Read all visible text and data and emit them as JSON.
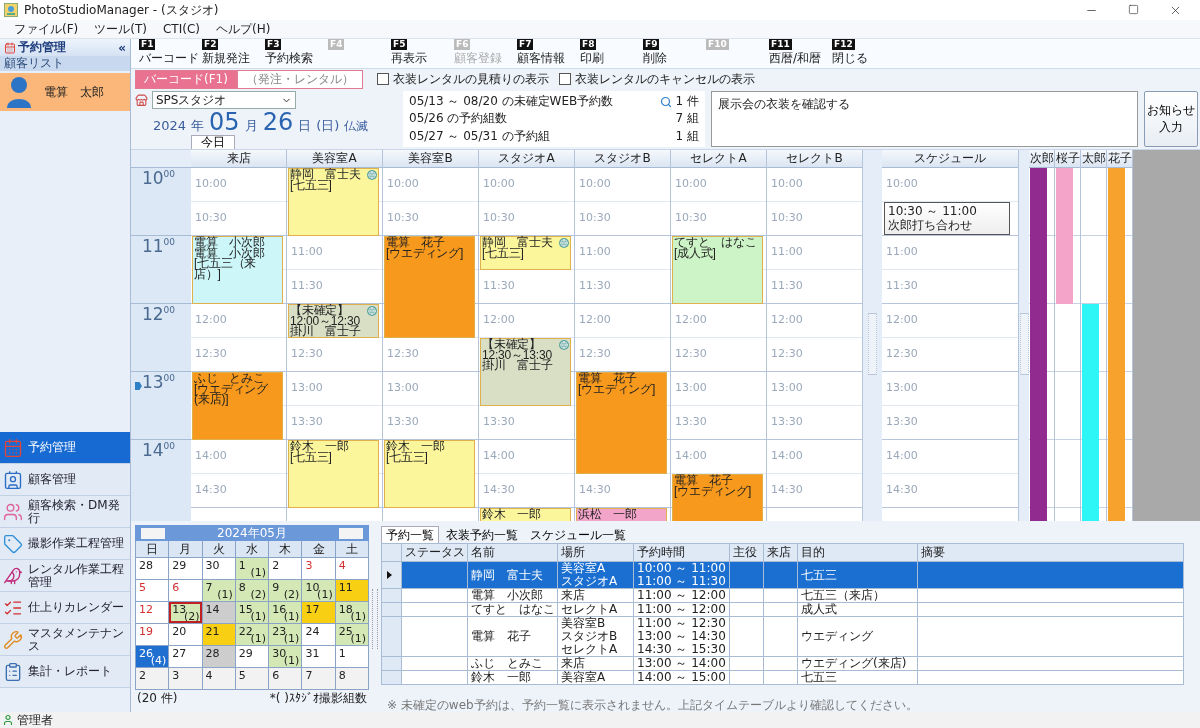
{
  "window": {
    "title": "PhotoStudioManager - (スタジオ)"
  },
  "menu": [
    "ファイル(F)",
    "ツール(T)",
    "CTI(C)",
    "ヘルプ(H)"
  ],
  "sidebar": {
    "title": "予約管理",
    "collapse": "«",
    "list_title": "顧客リスト",
    "customers": [
      {
        "name": "電算　太郎",
        "selected": true
      }
    ],
    "nav": [
      {
        "label": "予約管理",
        "selected": true
      },
      {
        "label": "顧客管理",
        "selected": false
      },
      {
        "label": "顧客検索・DM発行",
        "selected": false
      },
      {
        "label": "撮影作業工程管理",
        "selected": false
      },
      {
        "label": "レンタル作業工程管理",
        "selected": false
      },
      {
        "label": "仕上りカレンダー",
        "selected": false
      },
      {
        "label": "マスタメンテナンス",
        "selected": false
      },
      {
        "label": "集計・レポート",
        "selected": false
      }
    ]
  },
  "toolbar": [
    {
      "key": "F1",
      "label": "バーコード",
      "disabled": false
    },
    {
      "key": "F2",
      "label": "新規発注",
      "disabled": false
    },
    {
      "key": "F3",
      "label": "予約検索",
      "disabled": false
    },
    {
      "key": "F4",
      "disabled": true
    },
    {
      "key": "F5",
      "label": "再表示",
      "disabled": false
    },
    {
      "key": "F6",
      "label": "顧客登録",
      "disabled": true
    },
    {
      "key": "F7",
      "label": "顧客情報",
      "disabled": false
    },
    {
      "key": "F8",
      "label": "印刷",
      "disabled": false
    },
    {
      "key": "F9",
      "label": "削除",
      "disabled": false
    },
    {
      "key": "F10",
      "disabled": true
    },
    {
      "key": "F11",
      "label": "西暦/和暦",
      "disabled": false
    },
    {
      "key": "F12",
      "label": "閉じる",
      "disabled": false
    }
  ],
  "mode_tabs": [
    {
      "label": "バーコード(F1)",
      "selected": true
    },
    {
      "label": "（発注・レンタル）",
      "selected": false
    }
  ],
  "options": [
    {
      "label": "衣装レンタルの見積りの表示",
      "checked": false
    },
    {
      "label": "衣装レンタルのキャンセルの表示",
      "checked": false
    }
  ],
  "store": {
    "value": "SPSスタジオ"
  },
  "date": {
    "year": "2024",
    "year_unit": "年",
    "month": "05",
    "month_unit": "月",
    "day": "26",
    "day_unit": "日",
    "weekday": "(日)",
    "rokuyo": "仏滅",
    "today_button": "今日"
  },
  "summary": [
    {
      "label": "05/13 ～ 08/20 の未確定WEB予約数",
      "count": "1 件",
      "searchable": true
    },
    {
      "label": "05/26  の予約組数",
      "count": "7 組",
      "searchable": false
    },
    {
      "label": "05/27 ～ 05/31 の予約組",
      "count": "1 組",
      "searchable": false
    }
  ],
  "notice": {
    "text": "展示会の衣装を確認する",
    "button": [
      "お知らせ",
      "入力"
    ]
  },
  "timetable": {
    "hours": [
      {
        "hour": "10",
        "minute": "00",
        "current": false
      },
      {
        "hour": "11",
        "minute": "00",
        "current": false
      },
      {
        "hour": "12",
        "minute": "00",
        "current": false
      },
      {
        "hour": "13",
        "minute": "00",
        "current": true
      },
      {
        "hour": "14",
        "minute": "00",
        "current": false
      }
    ],
    "columns": [
      {
        "name": "来店",
        "cells": [
          {
            "kind": "slot",
            "label": "10:00"
          },
          {
            "kind": "slot",
            "label": "10:30"
          },
          {
            "kind": "booking",
            "color": "#ccf6f8",
            "web": false,
            "lines": [
              "電算　小次郎",
              "電算　小次郎",
              "[七五三（来店）]"
            ]
          },
          {
            "kind": "continued"
          },
          {
            "kind": "slot",
            "label": "12:00"
          },
          {
            "kind": "slot",
            "label": "12:30"
          },
          {
            "kind": "booking",
            "color": "#f7991c",
            "web": false,
            "lines": [
              "ふじ　とみこ",
              "[ウエディング(来店)]"
            ]
          },
          {
            "kind": "continued"
          },
          {
            "kind": "slot",
            "label": "14:00"
          },
          {
            "kind": "slot",
            "label": "14:30"
          },
          {
            "kind": "empty"
          }
        ]
      },
      {
        "name": "美容室A",
        "cells": [
          {
            "kind": "booking",
            "color": "#fbf59c",
            "web": true,
            "lines": [
              "静岡　富士夫",
              "[七五三]"
            ]
          },
          {
            "kind": "continued"
          },
          {
            "kind": "slot",
            "label": "11:00"
          },
          {
            "kind": "slot",
            "label": "11:30"
          },
          {
            "kind": "booking",
            "color": "#d9dfc4",
            "web": true,
            "lines": [
              "【未確定】",
              "12:00～12:30",
              "掛川　富士子"
            ]
          },
          {
            "kind": "slot",
            "label": "12:30"
          },
          {
            "kind": "slot",
            "label": "13:00"
          },
          {
            "kind": "slot",
            "label": "13:30"
          },
          {
            "kind": "booking",
            "color": "#fbf59c",
            "web": false,
            "lines": [
              "鈴木　一郎",
              "[七五三]"
            ]
          },
          {
            "kind": "continued"
          },
          {
            "kind": "empty"
          }
        ]
      },
      {
        "name": "美容室B",
        "cells": [
          {
            "kind": "slot",
            "label": "10:00"
          },
          {
            "kind": "slot",
            "label": "10:30"
          },
          {
            "kind": "booking",
            "color": "#f7991c",
            "web": false,
            "lines": [
              "電算　花子",
              "[ウエディング]"
            ]
          },
          {
            "kind": "continued"
          },
          {
            "kind": "continued"
          },
          {
            "kind": "slot",
            "label": "12:30"
          },
          {
            "kind": "slot",
            "label": "13:00"
          },
          {
            "kind": "slot",
            "label": "13:30"
          },
          {
            "kind": "booking",
            "color": "#fbf59c",
            "web": false,
            "lines": [
              "鈴木　一郎",
              "[七五三]"
            ]
          },
          {
            "kind": "continued"
          },
          {
            "kind": "empty"
          }
        ]
      },
      {
        "name": "スタジオA",
        "cells": [
          {
            "kind": "slot",
            "label": "10:00"
          },
          {
            "kind": "slot",
            "label": "10:30"
          },
          {
            "kind": "booking",
            "color": "#fbf59c",
            "web": true,
            "lines": [
              "静岡　富士夫",
              "[七五三]"
            ]
          },
          {
            "kind": "slot",
            "label": "11:30"
          },
          {
            "kind": "slot",
            "label": "12:00"
          },
          {
            "kind": "booking",
            "color": "#d9dfc4",
            "web": true,
            "lines": [
              "【未確定】",
              "12:30～13:30",
              "掛川　富士子"
            ]
          },
          {
            "kind": "continued"
          },
          {
            "kind": "slot",
            "label": "13:30"
          },
          {
            "kind": "slot",
            "label": "14:00"
          },
          {
            "kind": "slot",
            "label": "14:30"
          },
          {
            "kind": "booking",
            "color": "#fbf59c",
            "web": false,
            "lines": [
              "鈴木　一郎"
            ]
          }
        ]
      },
      {
        "name": "スタジオB",
        "cells": [
          {
            "kind": "slot",
            "label": "10:00"
          },
          {
            "kind": "slot",
            "label": "10:30"
          },
          {
            "kind": "slot",
            "label": "11:00"
          },
          {
            "kind": "slot",
            "label": "11:30"
          },
          {
            "kind": "slot",
            "label": "12:00"
          },
          {
            "kind": "slot",
            "label": "12:30"
          },
          {
            "kind": "booking",
            "color": "#f7991c",
            "web": false,
            "lines": [
              "電算　花子",
              "[ウエディング]"
            ]
          },
          {
            "kind": "continued"
          },
          {
            "kind": "continued"
          },
          {
            "kind": "slot",
            "label": "14:30"
          },
          {
            "kind": "booking",
            "color": "#f2a5c8",
            "web": false,
            "lines": [
              "浜松　一郎"
            ]
          }
        ]
      },
      {
        "name": "セレクトA",
        "cells": [
          {
            "kind": "slot",
            "label": "10:00"
          },
          {
            "kind": "slot",
            "label": "10:30"
          },
          {
            "kind": "booking",
            "color": "#cdf4c6",
            "web": false,
            "lines": [
              "てすと　はなこ",
              "[成人式]"
            ]
          },
          {
            "kind": "continued"
          },
          {
            "kind": "slot",
            "label": "12:00"
          },
          {
            "kind": "slot",
            "label": "12:30"
          },
          {
            "kind": "slot",
            "label": "13:00"
          },
          {
            "kind": "slot",
            "label": "13:30"
          },
          {
            "kind": "slot",
            "label": "14:00"
          },
          {
            "kind": "booking",
            "color": "#f7991c",
            "web": false,
            "lines": [
              "電算　花子",
              "[ウエディング]"
            ]
          },
          {
            "kind": "continued"
          }
        ]
      },
      {
        "name": "セレクトB",
        "cells": [
          {
            "kind": "slot",
            "label": "10:00"
          },
          {
            "kind": "slot",
            "label": "10:30"
          },
          {
            "kind": "slot",
            "label": "11:00"
          },
          {
            "kind": "slot",
            "label": "11:30"
          },
          {
            "kind": "slot",
            "label": "12:00"
          },
          {
            "kind": "slot",
            "label": "12:30"
          },
          {
            "kind": "slot",
            "label": "13:00"
          },
          {
            "kind": "slot",
            "label": "13:30"
          },
          {
            "kind": "slot",
            "label": "14:00"
          },
          {
            "kind": "slot",
            "label": "14:30"
          },
          {
            "kind": "empty"
          }
        ]
      }
    ],
    "schedule": {
      "title": "スケジュール",
      "cells": [
        {
          "kind": "slot",
          "label": "10:00"
        },
        {
          "kind": "booking",
          "lines": [
            "10:30 ～ 11:00",
            "次郎打ち合わせ"
          ]
        },
        {
          "kind": "slot",
          "label": "11:00"
        },
        {
          "kind": "slot",
          "label": "11:30"
        },
        {
          "kind": "slot",
          "label": "12:00"
        },
        {
          "kind": "slot",
          "label": "12:30"
        },
        {
          "kind": "slot",
          "label": "13:00"
        },
        {
          "kind": "slot",
          "label": "13:30"
        },
        {
          "kind": "slot",
          "label": "14:00"
        },
        {
          "kind": "slot",
          "label": "14:30"
        },
        {
          "kind": "empty"
        }
      ]
    },
    "staff": [
      {
        "name": "次郎",
        "color": "#922b8f",
        "cells": [
          {
            "kind": "bar"
          },
          {
            "kind": "continued"
          },
          {
            "kind": "continued"
          },
          {
            "kind": "continued"
          },
          {
            "kind": "continued"
          },
          {
            "kind": "continued"
          },
          {
            "kind": "continued"
          },
          {
            "kind": "continued"
          },
          {
            "kind": "continued"
          },
          {
            "kind": "continued"
          },
          {
            "kind": "continued"
          }
        ]
      },
      {
        "name": "桜子",
        "color": "#f4a3c9",
        "cells": [
          {
            "kind": "bar"
          },
          {
            "kind": "continued"
          },
          {
            "kind": "continued"
          },
          {
            "kind": "continued"
          },
          {
            "kind": "empty"
          },
          {
            "kind": "empty"
          },
          {
            "kind": "empty"
          },
          {
            "kind": "empty"
          },
          {
            "kind": "empty"
          },
          {
            "kind": "empty"
          },
          {
            "kind": "empty"
          }
        ]
      },
      {
        "name": "太郎",
        "color": "#2ef6f6",
        "cells": [
          {
            "kind": "empty"
          },
          {
            "kind": "empty"
          },
          {
            "kind": "empty"
          },
          {
            "kind": "empty"
          },
          {
            "kind": "bar"
          },
          {
            "kind": "continued"
          },
          {
            "kind": "continued"
          },
          {
            "kind": "continued"
          },
          {
            "kind": "continued"
          },
          {
            "kind": "continued"
          },
          {
            "kind": "continued"
          }
        ]
      },
      {
        "name": "花子",
        "color": "#f7a22c",
        "cells": [
          {
            "kind": "bar"
          },
          {
            "kind": "continued"
          },
          {
            "kind": "continued"
          },
          {
            "kind": "continued"
          },
          {
            "kind": "continued"
          },
          {
            "kind": "continued"
          },
          {
            "kind": "continued"
          },
          {
            "kind": "continued"
          },
          {
            "kind": "continued"
          },
          {
            "kind": "continued"
          },
          {
            "kind": "continued"
          }
        ]
      }
    ]
  },
  "calendar": {
    "title": "2024年05月",
    "weekdays": [
      "日",
      "月",
      "火",
      "水",
      "木",
      "金",
      "土"
    ],
    "weeks": [
      [
        {
          "day": "28",
          "kind": "plain",
          "red": false,
          "outlined": false
        },
        {
          "day": "29",
          "kind": "plain",
          "red": false,
          "outlined": false
        },
        {
          "day": "30",
          "kind": "plain",
          "red": false,
          "outlined": false
        },
        {
          "day": "1",
          "count": "(1)",
          "kind": "booked",
          "red": false,
          "outlined": false
        },
        {
          "day": "2",
          "kind": "plain",
          "red": false,
          "outlined": false
        },
        {
          "day": "3",
          "kind": "plain",
          "red": true,
          "outlined": false
        },
        {
          "day": "4",
          "kind": "plain",
          "red": true,
          "outlined": false
        }
      ],
      [
        {
          "day": "5",
          "kind": "plain",
          "red": true,
          "outlined": false
        },
        {
          "day": "6",
          "kind": "plain",
          "red": true,
          "outlined": false
        },
        {
          "day": "7",
          "count": "(1)",
          "kind": "booked",
          "red": false,
          "outlined": false
        },
        {
          "day": "8",
          "count": "(2)",
          "kind": "booked",
          "red": false,
          "outlined": false
        },
        {
          "day": "9",
          "count": "(2)",
          "kind": "booked",
          "red": false,
          "outlined": false
        },
        {
          "day": "10",
          "count": "(1)",
          "kind": "booked",
          "red": false,
          "outlined": false
        },
        {
          "day": "11",
          "kind": "yellow",
          "red": false,
          "outlined": false
        }
      ],
      [
        {
          "day": "12",
          "kind": "plain",
          "red": true,
          "outlined": false
        },
        {
          "day": "13",
          "count": "(2)",
          "kind": "booked",
          "red": false,
          "outlined": true
        },
        {
          "day": "14",
          "kind": "gray",
          "red": false,
          "outlined": false
        },
        {
          "day": "15",
          "count": "(1)",
          "kind": "booked",
          "red": false,
          "outlined": false
        },
        {
          "day": "16",
          "count": "(1)",
          "kind": "booked",
          "red": false,
          "outlined": false
        },
        {
          "day": "17",
          "kind": "yellow",
          "red": false,
          "outlined": false
        },
        {
          "day": "18",
          "count": "(1)",
          "kind": "booked",
          "red": false,
          "outlined": false
        }
      ],
      [
        {
          "day": "19",
          "kind": "plain",
          "red": true,
          "outlined": false
        },
        {
          "day": "20",
          "kind": "plain",
          "red": false,
          "outlined": false
        },
        {
          "day": "21",
          "kind": "yellow",
          "red": false,
          "outlined": false
        },
        {
          "day": "22",
          "count": "(1)",
          "kind": "booked",
          "red": false,
          "outlined": false
        },
        {
          "day": "23",
          "count": "(1)",
          "kind": "booked",
          "red": false,
          "outlined": false
        },
        {
          "day": "24",
          "kind": "plain",
          "red": false,
          "outlined": false
        },
        {
          "day": "25",
          "count": "(1)",
          "kind": "booked",
          "red": false,
          "outlined": false
        }
      ],
      [
        {
          "day": "26",
          "count": "(4)",
          "kind": "current",
          "red": false,
          "outlined": false
        },
        {
          "day": "27",
          "kind": "plain",
          "red": false,
          "outlined": false
        },
        {
          "day": "28",
          "kind": "gray",
          "red": false,
          "outlined": false
        },
        {
          "day": "29",
          "kind": "plain",
          "red": false,
          "outlined": false
        },
        {
          "day": "30",
          "count": "(1)",
          "kind": "booked",
          "red": false,
          "outlined": false
        },
        {
          "day": "31",
          "kind": "plain",
          "red": false,
          "outlined": false
        },
        {
          "day": "1",
          "kind": "plain",
          "red": false,
          "outlined": false
        }
      ],
      [
        {
          "day": "2",
          "kind": "muted",
          "red": false,
          "outlined": false
        },
        {
          "day": "3",
          "kind": "muted",
          "red": false,
          "outlined": false
        },
        {
          "day": "4",
          "kind": "muted",
          "red": false,
          "outlined": false
        },
        {
          "day": "5",
          "kind": "muted",
          "red": false,
          "outlined": false
        },
        {
          "day": "6",
          "kind": "muted",
          "red": false,
          "outlined": false
        },
        {
          "day": "7",
          "kind": "muted",
          "red": false,
          "outlined": false
        },
        {
          "day": "8",
          "kind": "muted",
          "red": false,
          "outlined": false
        }
      ]
    ],
    "total": "(20 件)",
    "legend": "*( )ｽﾀｼﾞｵ撮影組数"
  },
  "list": {
    "tabs": [
      {
        "label": "予約一覧",
        "selected": true
      },
      {
        "label": "衣装予約一覧",
        "selected": false
      },
      {
        "label": "スケジュール一覧",
        "selected": false
      }
    ],
    "columns": [
      "ステータス",
      "名前",
      "場所",
      "予約時間",
      "主役",
      "来店",
      "目的",
      "摘要"
    ],
    "rows": [
      {
        "name": "静岡　富士夫",
        "places": [
          "美容室A",
          "スタジオA"
        ],
        "times": [
          "10:00 ～ 11:00",
          "11:00 ～ 11:30"
        ],
        "purpose": "七五三",
        "selected": true
      },
      {
        "name": "電算　小次郎",
        "places": [
          "来店"
        ],
        "times": [
          "11:00 ～ 12:00"
        ],
        "purpose": "七五三（来店）",
        "selected": false
      },
      {
        "name": "てすと　はなこ",
        "places": [
          "セレクトA"
        ],
        "times": [
          "11:00 ～ 12:00"
        ],
        "purpose": "成人式",
        "selected": false
      },
      {
        "name": "電算　花子",
        "places": [
          "美容室B",
          "スタジオB",
          "セレクトA"
        ],
        "times": [
          "11:00 ～ 12:30",
          "13:00 ～ 14:30",
          "14:30 ～ 15:30"
        ],
        "purpose": "ウエディング",
        "selected": false
      },
      {
        "name": "ふじ　とみこ",
        "places": [
          "来店"
        ],
        "times": [
          "13:00 ～ 14:00"
        ],
        "purpose": "ウエディング(来店)",
        "selected": false
      },
      {
        "name": "鈴木　一郎",
        "places": [
          "美容室A"
        ],
        "times": [
          "14:00 ～ 15:00"
        ],
        "purpose": "七五三",
        "selected": false
      }
    ],
    "note": "※ 未確定のweb予約は、予約一覧に表示されません。上記タイムテーブルより確認してください。"
  },
  "status": {
    "user": "管理者"
  }
}
